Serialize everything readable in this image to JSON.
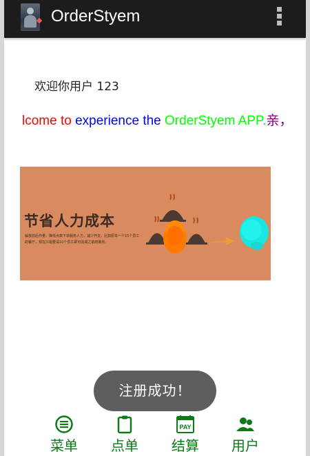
{
  "app": {
    "title": "OrderStyem"
  },
  "icons": {
    "app_icon": "app-icon",
    "overflow_menu": "overflow-menu-icon",
    "menu": "list-icon",
    "order": "clipboard-icon",
    "checkout": "pay-icon",
    "user": "users-icon"
  },
  "main": {
    "welcome_user": "欢迎你用户 123",
    "marquee": [
      {
        "text": "lcome to ",
        "color": "#ff0000"
      },
      {
        "text": "experience the ",
        "color": "#0000ff"
      },
      {
        "text": "OrderStyem APP.",
        "color": "#00ff00"
      },
      {
        "text": "亲，",
        "color": "#800080"
      }
    ],
    "banner": {
      "title": "节省人力成本",
      "description": "解放前后作量，降低点菜下单服务人力，减少开支，比如原本一个15个员工的餐厅，现在只需要请10个员工即可完成之前的服务。"
    }
  },
  "toast": {
    "message": "注册成功！"
  },
  "bottom_nav": {
    "color": "#0c7a17",
    "items": [
      {
        "label": "菜单",
        "icon": "list-icon"
      },
      {
        "label": "点单",
        "icon": "clipboard-icon"
      },
      {
        "label": "结算",
        "icon": "pay-icon",
        "icon_text": "PAY"
      },
      {
        "label": "用户",
        "icon": "users-icon"
      }
    ]
  }
}
